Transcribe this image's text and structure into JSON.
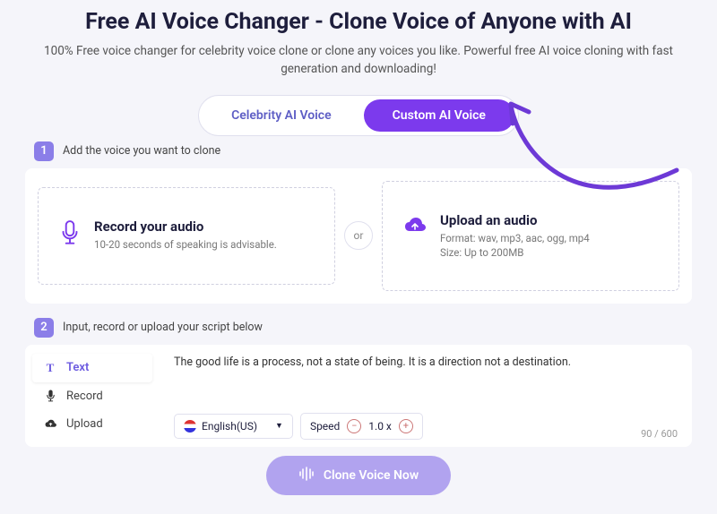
{
  "header": {
    "title": "Free AI Voice Changer - Clone Voice of Anyone with AI",
    "subtitle": "100% Free voice changer for celebrity voice clone or clone any voices you like. Powerful free AI voice cloning with fast generation and downloading!"
  },
  "tabs": {
    "celebrity": "Celebrity AI Voice",
    "custom": "Custom AI Voice"
  },
  "step1": {
    "num": "1",
    "label": "Add the voice you want to clone",
    "record": {
      "title": "Record your audio",
      "desc": "10-20 seconds of speaking is advisable."
    },
    "or": "or",
    "upload": {
      "title": "Upload an audio",
      "desc": "Format: wav, mp3, aac, ogg, mp4\nSize: Up to 200MB"
    }
  },
  "step2": {
    "num": "2",
    "label": "Input, record or upload your script below",
    "inputTabs": {
      "text": "Text",
      "record": "Record",
      "upload": "Upload"
    },
    "script": "The good life is a process, not a state of being. It is a direction not a destination.",
    "language": "English(US)",
    "speed_label": "Speed",
    "speed_value": "1.0 x",
    "counter": "90 / 600"
  },
  "cta": "Clone Voice Now"
}
